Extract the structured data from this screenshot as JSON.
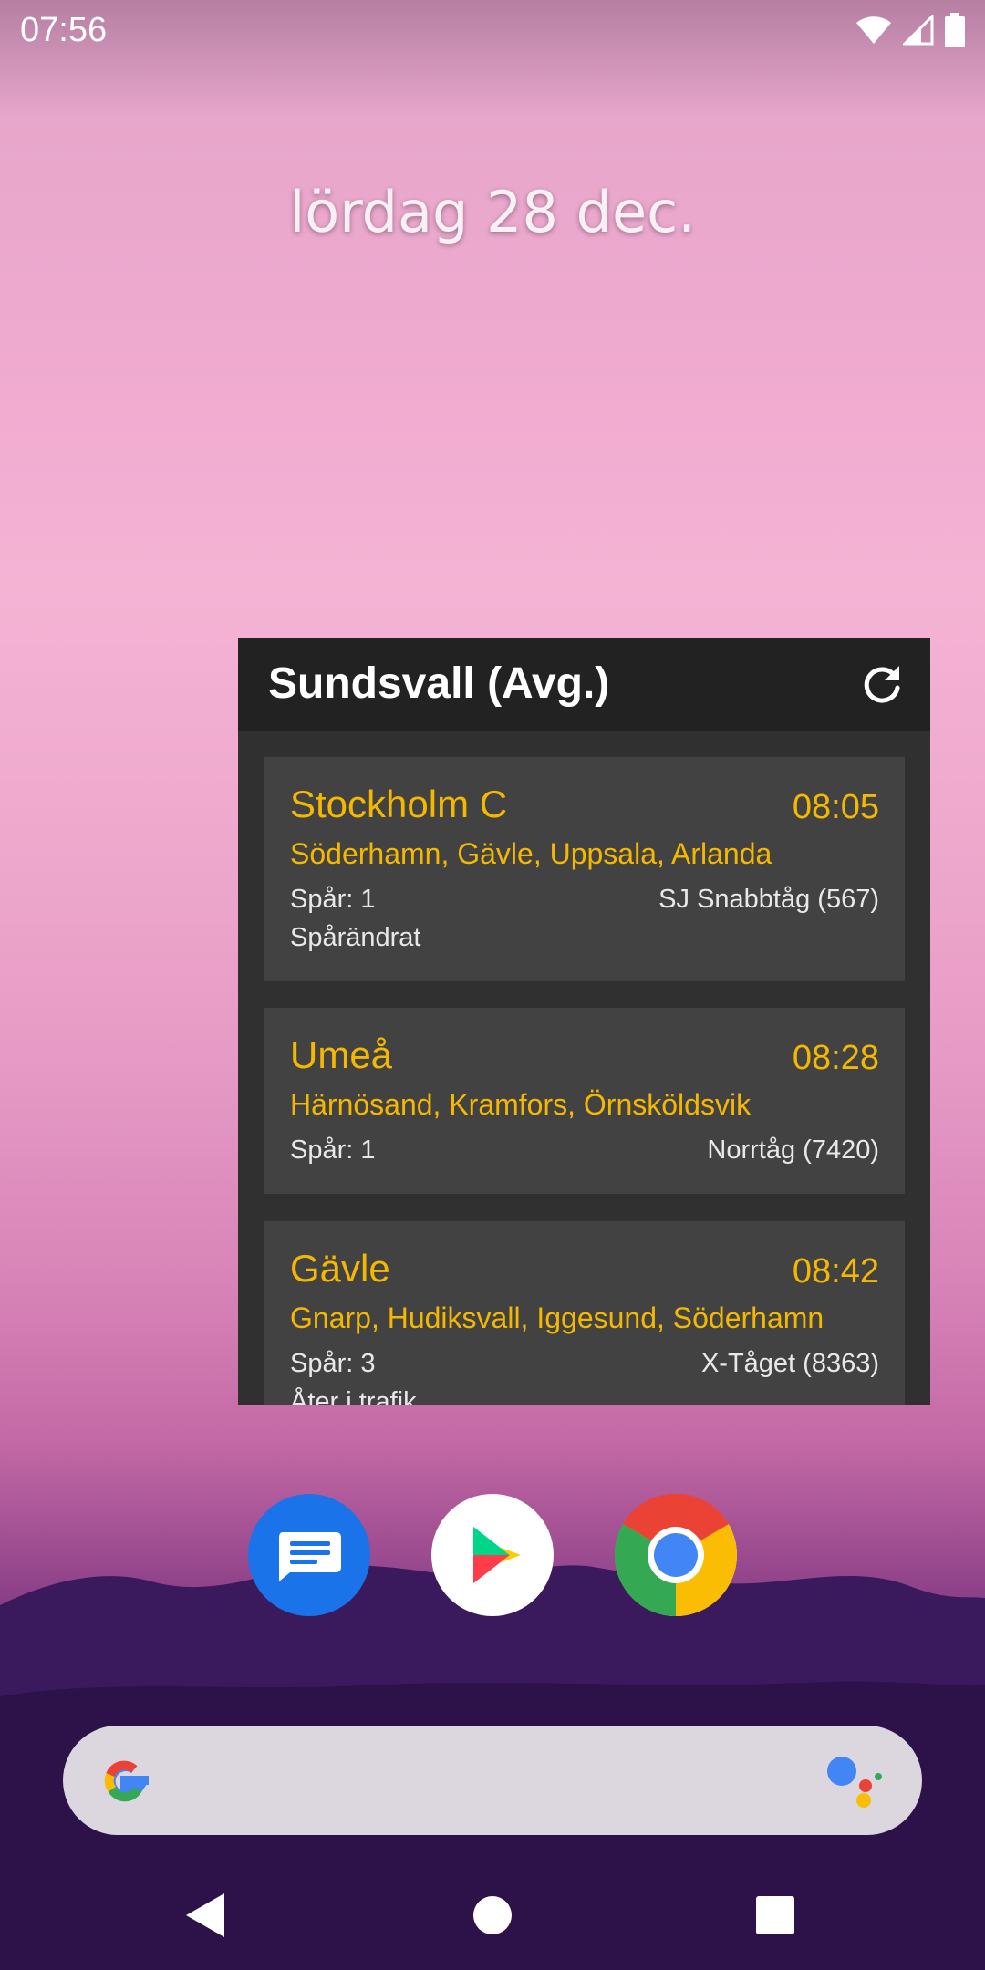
{
  "status_bar": {
    "time": "07:56",
    "icons": [
      "wifi-icon",
      "cell-signal-icon",
      "battery-icon"
    ]
  },
  "home": {
    "date": "lördag 28 dec."
  },
  "widget": {
    "title": "Sundsvall (Avg.)",
    "refresh_icon": "refresh-icon",
    "departures": [
      {
        "destination": "Stockholm C",
        "time": "08:05",
        "via": "Söderhamn, Gävle, Uppsala, Arlanda",
        "track": "Spår: 1",
        "train": "SJ Snabbtåg (567)",
        "note": "Spårändrat"
      },
      {
        "destination": "Umeå",
        "time": "08:28",
        "via": "Härnösand, Kramfors, Örnsköldsvik",
        "track": "Spår: 1",
        "train": "Norrtåg (7420)",
        "note": ""
      },
      {
        "destination": "Gävle",
        "time": "08:42",
        "via": "Gnarp, Hudiksvall, Iggesund, Söderhamn",
        "track": "Spår: 3",
        "train": "X-Tåget (8363)",
        "note": "Åter i trafik"
      }
    ]
  },
  "dock": {
    "apps": [
      "messages-icon",
      "play-store-icon",
      "chrome-icon"
    ]
  },
  "search": {
    "left_icon": "google-g-icon",
    "right_icon": "google-assistant-icon"
  },
  "nav": {
    "buttons": [
      "back-button",
      "home-button",
      "recents-button"
    ]
  },
  "colors": {
    "accent": "#f5b800",
    "widget_bg": "#303030",
    "card_bg": "#424242",
    "header_bg": "#222222"
  }
}
